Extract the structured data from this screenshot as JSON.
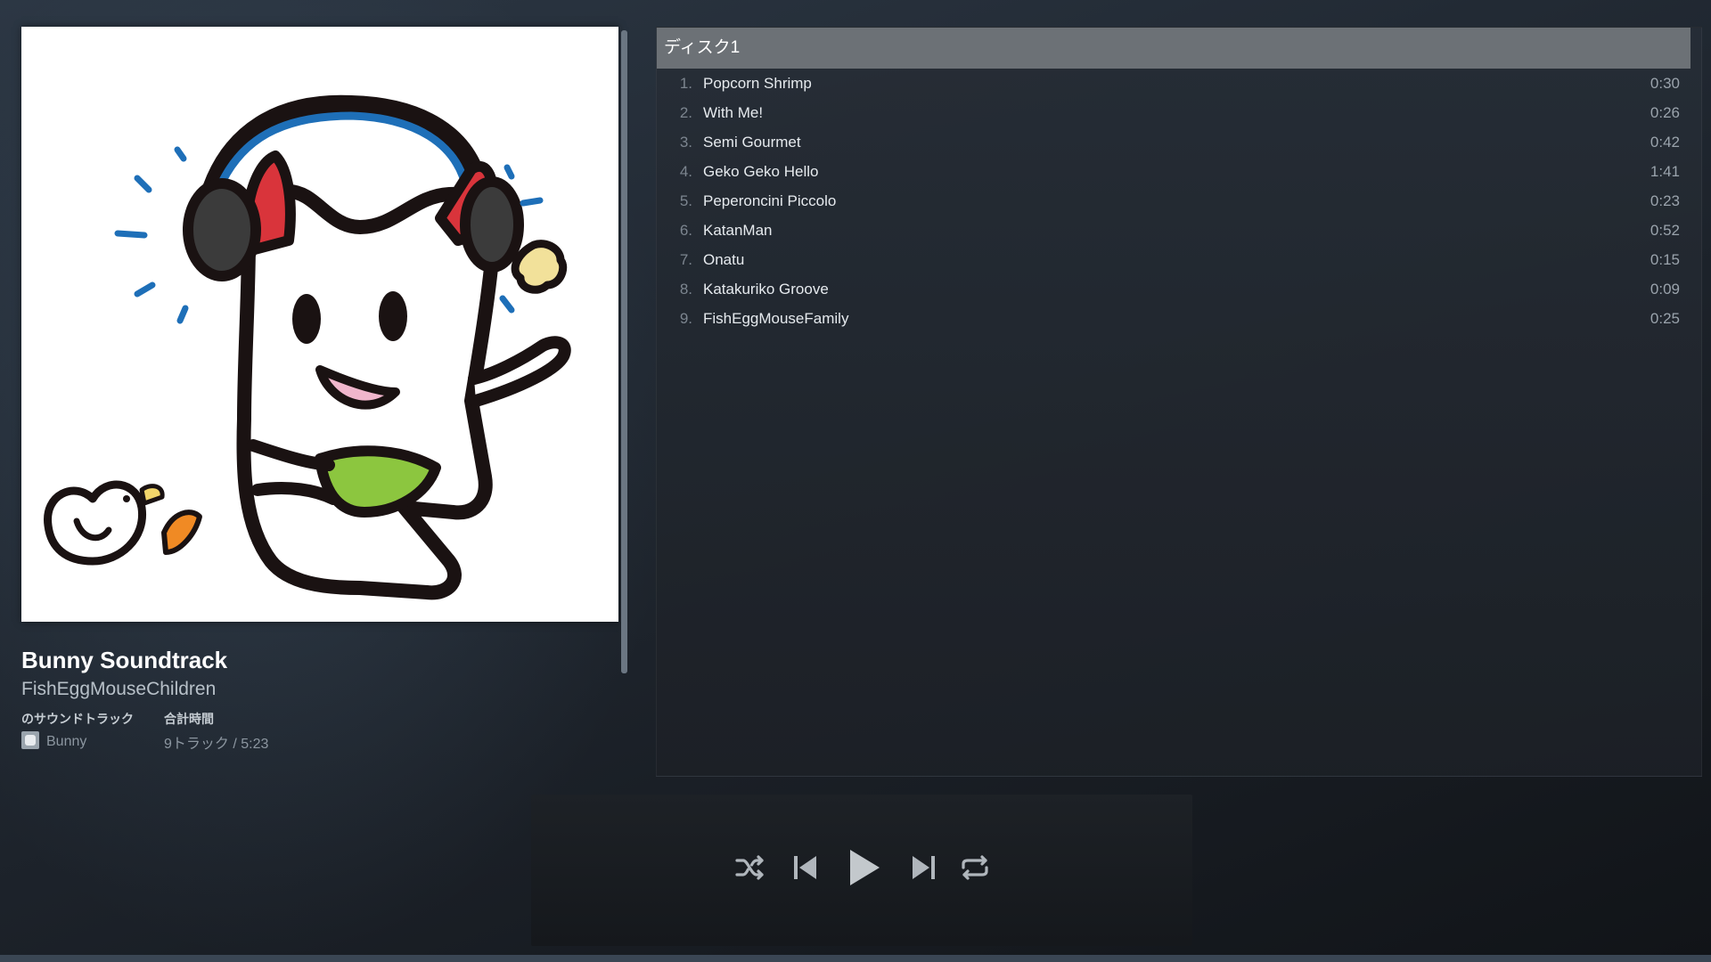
{
  "album": {
    "title": "Bunny Soundtrack",
    "artist": "FishEggMouseChildren",
    "soundtrack_of_label": "のサウンドトラック",
    "soundtrack_of_value": "Bunny",
    "total_time_label": "合計時間",
    "total_time_value": "9トラック / 5:23"
  },
  "tracklist": {
    "disc_label": "ディスク1",
    "tracks": [
      {
        "num": "1.",
        "name": "Popcorn Shrimp",
        "duration": "0:30"
      },
      {
        "num": "2.",
        "name": "With Me!",
        "duration": "0:26"
      },
      {
        "num": "3.",
        "name": "Semi Gourmet",
        "duration": "0:42"
      },
      {
        "num": "4.",
        "name": "Geko Geko Hello",
        "duration": "1:41"
      },
      {
        "num": "5.",
        "name": "Peperoncini Piccolo",
        "duration": "0:23"
      },
      {
        "num": "6.",
        "name": "KatanMan",
        "duration": "0:52"
      },
      {
        "num": "7.",
        "name": "Onatu",
        "duration": "0:15"
      },
      {
        "num": "8.",
        "name": "Katakuriko Groove",
        "duration": "0:09"
      },
      {
        "num": "9.",
        "name": "FishEggMouseFamily",
        "duration": "0:25"
      }
    ]
  },
  "player": {
    "controls": [
      "shuffle-icon",
      "previous-icon",
      "play-icon",
      "next-icon",
      "repeat-icon"
    ]
  },
  "colors": {
    "accent_blue": "#1e6fb8",
    "ear_red": "#d9343b",
    "belly_green": "#8cc63f",
    "control_gray": "#b0b6bc"
  }
}
